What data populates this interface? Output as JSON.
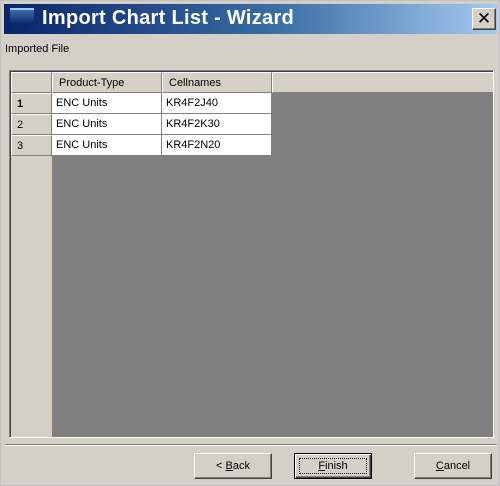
{
  "window": {
    "title": "Import Chart List - Wizard",
    "close_glyph": "✕"
  },
  "section_label": "Imported File",
  "grid": {
    "columns": [
      "Product-Type",
      "Cellnames"
    ],
    "rows": [
      {
        "num": "1",
        "cells": [
          "ENC Units",
          "KR4F2J40"
        ]
      },
      {
        "num": "2",
        "cells": [
          "ENC Units",
          "KR4F2K30"
        ]
      },
      {
        "num": "3",
        "cells": [
          "ENC Units",
          "KR4F2N20"
        ]
      }
    ]
  },
  "buttons": {
    "back": {
      "prefix": "< ",
      "mnemonic": "B",
      "rest": "ack"
    },
    "finish": {
      "prefix": "",
      "mnemonic": "F",
      "rest": "inish"
    },
    "cancel": {
      "prefix": "",
      "mnemonic": "C",
      "rest": "ancel"
    }
  },
  "colors": {
    "titlebar_start": "#0a246a",
    "titlebar_end": "#a6caf0",
    "face": "#d4d0c8",
    "grid_empty": "#808080"
  },
  "icons": {
    "app": "app-icon",
    "close": "close-icon"
  }
}
